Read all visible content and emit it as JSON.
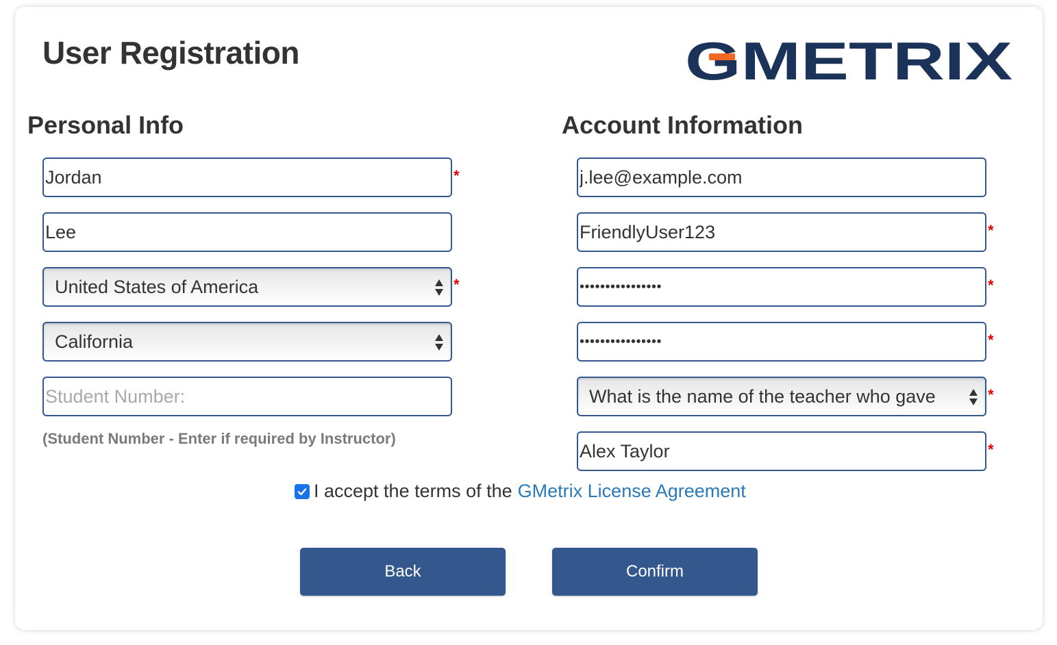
{
  "header": {
    "title": "User Registration",
    "logo_text": "GMETRIX",
    "brand_colors": {
      "navy": "#1b3359",
      "orange": "#f26722"
    }
  },
  "personal": {
    "section_title": "Personal Info",
    "first_name": "Jordan",
    "last_name": "Lee",
    "country": "United States of America",
    "state": "California",
    "student_number_placeholder": "Student Number:",
    "student_number_value": "",
    "student_number_hint": "(Student Number - Enter if required by Instructor)"
  },
  "account": {
    "section_title": "Account Information",
    "email": "j.lee@example.com",
    "username": "FriendlyUser123",
    "password_mask": "••••••••••••••••",
    "confirm_password_mask": "••••••••••••••••",
    "security_question": "What is the name of the teacher who gave",
    "security_answer": "Alex Taylor"
  },
  "required_marker": "*",
  "terms": {
    "checked": true,
    "text": "I accept the terms of the",
    "link_text": "GMetrix License Agreement"
  },
  "buttons": {
    "back": "Back",
    "confirm": "Confirm"
  }
}
